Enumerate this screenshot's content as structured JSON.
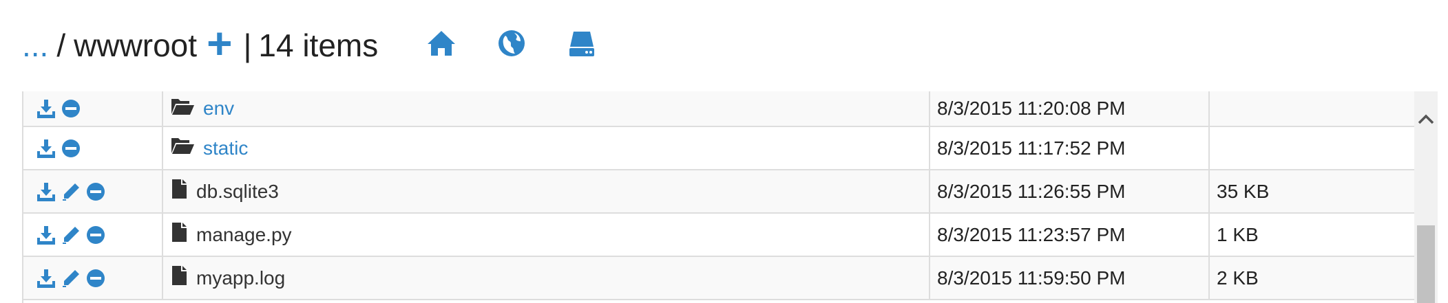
{
  "breadcrumb": {
    "ellipsis": "...",
    "separator": "/",
    "current_folder": "wwwroot",
    "pipe": "|",
    "item_count": "14 items"
  },
  "header_icons": [
    "home-icon",
    "globe-icon",
    "drive-icon"
  ],
  "colors": {
    "accent": "#2f85c8",
    "row_alt": "#ffffff",
    "row": "#f9f9f9",
    "border": "#dddddd"
  },
  "files": [
    {
      "name": "env",
      "type": "folder",
      "modified": "8/3/2015 11:20:08 PM",
      "size": "",
      "actions": [
        "download",
        "delete"
      ]
    },
    {
      "name": "static",
      "type": "folder",
      "modified": "8/3/2015 11:17:52 PM",
      "size": "",
      "actions": [
        "download",
        "delete"
      ]
    },
    {
      "name": "db.sqlite3",
      "type": "file",
      "modified": "8/3/2015 11:26:55 PM",
      "size": "35 KB",
      "actions": [
        "download",
        "edit",
        "delete"
      ]
    },
    {
      "name": "manage.py",
      "type": "file",
      "modified": "8/3/2015 11:23:57 PM",
      "size": "1 KB",
      "actions": [
        "download",
        "edit",
        "delete"
      ]
    },
    {
      "name": "myapp.log",
      "type": "file",
      "modified": "8/3/2015 11:59:50 PM",
      "size": "2 KB",
      "actions": [
        "download",
        "edit",
        "delete"
      ]
    }
  ]
}
